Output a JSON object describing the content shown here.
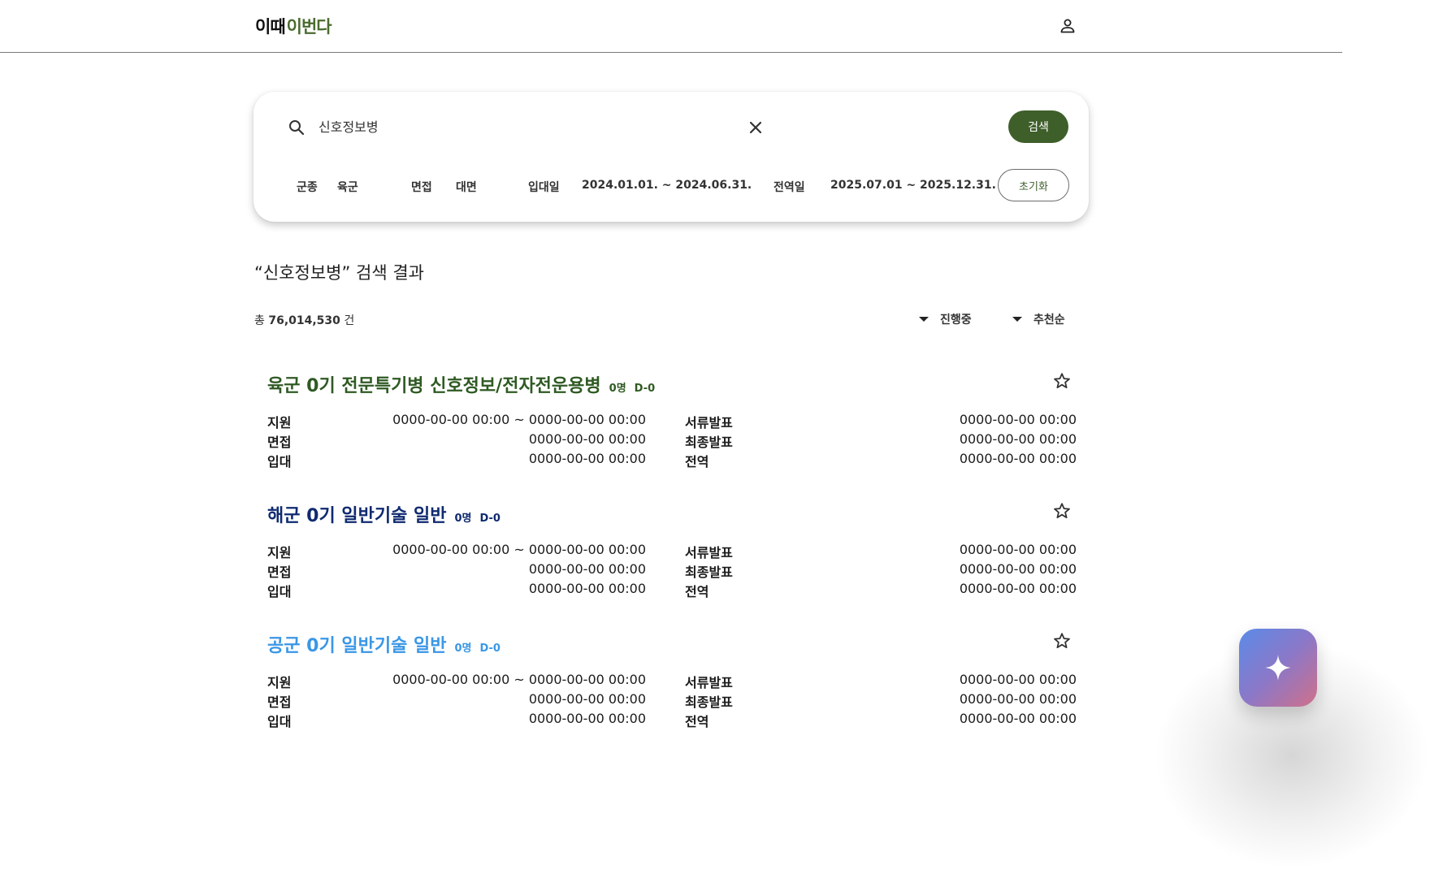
{
  "header": {
    "logo_part1": "이때",
    "logo_part2": "이번다"
  },
  "search": {
    "query": "신호정보병",
    "button_label": "검색",
    "reset_label": "초기화",
    "filters": {
      "branch_label": "군종",
      "branch_value": "육군",
      "interview_label": "면접",
      "interview_value": "대면",
      "enlist_label": "입대일",
      "enlist_value": "2024.01.01. ~ 2024.06.31.",
      "discharge_label": "전역일",
      "discharge_value": "2025.07.01 ~ 2025.12.31."
    }
  },
  "results": {
    "title": "“신호정보병” 검색 결과",
    "total_prefix": "총",
    "total_count": "76,014,530",
    "total_suffix": "건",
    "status_filter": "진행중",
    "sort": "추천순"
  },
  "colors": {
    "army": "#2f5a23",
    "navy": "#0f2a70",
    "airforce": "#3a97e6",
    "accent": "#3e5f2a"
  },
  "listings": [
    {
      "title": "육군 0기 전문특기병 신호정보/전자전운용병",
      "count": "0명",
      "dday": "D-0",
      "rows": [
        {
          "l1": "지원",
          "v1": "0000-00-00 00:00 ~ 0000-00-00 00:00",
          "l2": "서류발표",
          "v2": "0000-00-00 00:00"
        },
        {
          "l1": "면접",
          "v1": "0000-00-00 00:00",
          "l2": "최종발표",
          "v2": "0000-00-00 00:00"
        },
        {
          "l1": "입대",
          "v1": "0000-00-00 00:00",
          "l2": "전역",
          "v2": "0000-00-00 00:00"
        }
      ]
    },
    {
      "title": "해군 0기 일반기술 일반",
      "count": "0명",
      "dday": "D-0",
      "rows": [
        {
          "l1": "지원",
          "v1": "0000-00-00 00:00 ~ 0000-00-00 00:00",
          "l2": "서류발표",
          "v2": "0000-00-00 00:00"
        },
        {
          "l1": "면접",
          "v1": "0000-00-00 00:00",
          "l2": "최종발표",
          "v2": "0000-00-00 00:00"
        },
        {
          "l1": "입대",
          "v1": "0000-00-00 00:00",
          "l2": "전역",
          "v2": "0000-00-00 00:00"
        }
      ]
    },
    {
      "title": "공군 0기 일반기술 일반",
      "count": "0명",
      "dday": "D-0",
      "rows": [
        {
          "l1": "지원",
          "v1": "0000-00-00 00:00 ~ 0000-00-00 00:00",
          "l2": "서류발표",
          "v2": "0000-00-00 00:00"
        },
        {
          "l1": "면접",
          "v1": "0000-00-00 00:00",
          "l2": "최종발표",
          "v2": "0000-00-00 00:00"
        },
        {
          "l1": "입대",
          "v1": "0000-00-00 00:00",
          "l2": "전역",
          "v2": "0000-00-00 00:00"
        }
      ]
    }
  ],
  "icons": {
    "profile": "person-icon",
    "search": "search-icon",
    "clear": "close-icon",
    "favorite": "star-outline-icon",
    "ai": "sparkle-icon",
    "dropdown": "caret-down-icon"
  }
}
